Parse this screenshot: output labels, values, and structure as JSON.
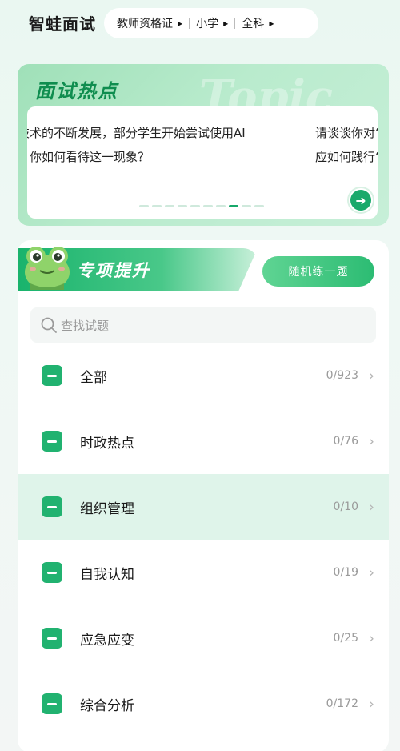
{
  "header": {
    "app_title": "智蛙面试",
    "filters": [
      {
        "label": "教师资格证"
      },
      {
        "label": "小学"
      },
      {
        "label": "全科"
      }
    ]
  },
  "hot": {
    "title": "面试热点",
    "watermark": "Topic",
    "topic_a": [
      "技术的不断发展，部分学生开始尝试使用AI",
      "。你如何看待这一现象？"
    ],
    "topic_b": [
      "请谈谈你对“",
      "应如何践行“"
    ],
    "dots_total": 10,
    "dots_active_index": 7
  },
  "special": {
    "title": "专项提升",
    "random_label": "随机练一题",
    "search_placeholder": "查找试题",
    "items": [
      {
        "label": "全部",
        "count": "0/923"
      },
      {
        "label": "时政热点",
        "count": "0/76"
      },
      {
        "label": "组织管理",
        "count": "0/10"
      },
      {
        "label": "自我认知",
        "count": "0/19"
      },
      {
        "label": "应急应变",
        "count": "0/25"
      },
      {
        "label": "综合分析",
        "count": "0/172"
      }
    ]
  },
  "colors": {
    "accent": "#21b270",
    "highlight_row": "#dff4ea"
  }
}
